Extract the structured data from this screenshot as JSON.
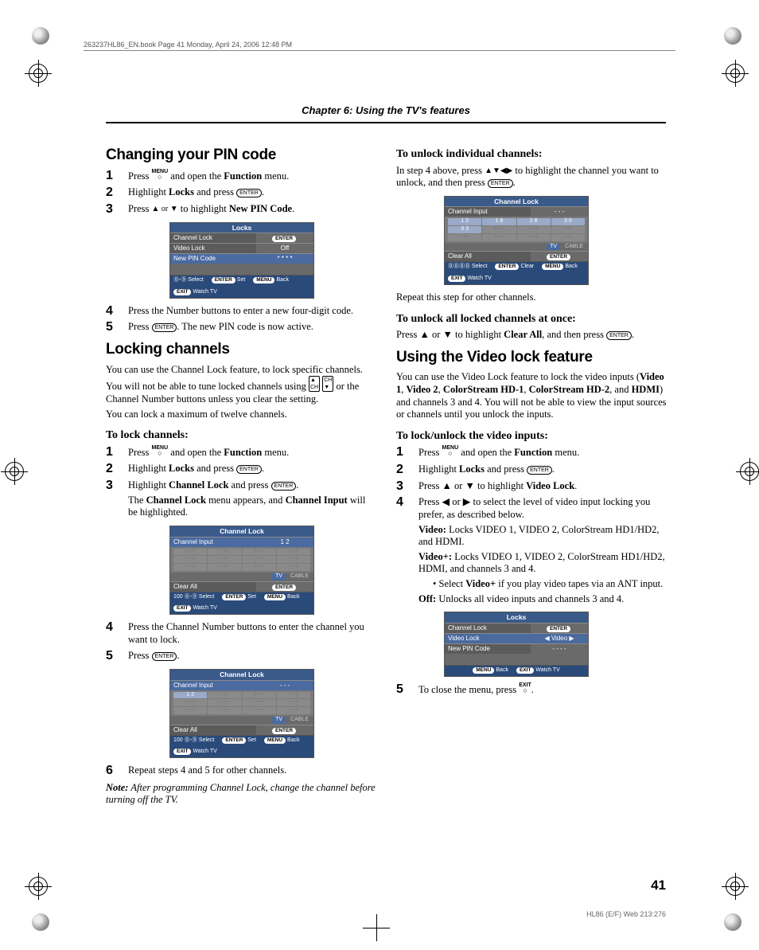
{
  "header_line": "263237HL86_EN.book  Page 41  Monday, April 24, 2006  12:48 PM",
  "chapter": "Chapter 6: Using the TV's features",
  "page_number": "41",
  "footer_right": "HL86 (E/F) Web 213:276",
  "left": {
    "h_changing": "Changing your PIN code",
    "steps_changing": [
      {
        "pre": "Press ",
        "icon": "MENU",
        "post": " and open the ",
        "bold": "Function",
        "tail": " menu."
      },
      {
        "pre": "Highlight ",
        "bold": "Locks",
        "post": " and press ",
        "icon2": "ENTER",
        "tail": "."
      },
      {
        "pre": "Press ",
        "tri": "▲ or ▼",
        "post": " to highlight ",
        "bold": "New PIN Code",
        "tail": "."
      }
    ],
    "step4_changing": "Press the Number buttons to enter a new four-digit code.",
    "step5_changing_pre": "Press ",
    "step5_changing_post": ". The new PIN code is now active.",
    "h_locking": "Locking channels",
    "locking_p1_a": "You can use the Channel Lock feature, to lock specific channels. You will not be able to tune locked channels using ",
    "locking_p1_b": " or the Channel Number buttons unless you clear the setting.",
    "locking_p2": "You can lock a maximum of twelve channels.",
    "sub_lock": "To lock channels:",
    "steps_lock": {
      "s1": {
        "pre": "Press ",
        "icon": "MENU",
        "post": " and open the ",
        "bold": "Function",
        "tail": " menu."
      },
      "s2": {
        "pre": "Highlight ",
        "bold": "Locks",
        "post": " and press ",
        "tail": "."
      },
      "s3a": {
        "pre": "Highlight ",
        "bold": "Channel Lock",
        "post": " and press ",
        "tail": "."
      },
      "s3b_pre": "The ",
      "s3b_b1": "Channel Lock",
      "s3b_mid": " menu appears, and ",
      "s3b_b2": "Channel Input",
      "s3b_post": " will be highlighted.",
      "s4": "Press the Channel Number buttons to enter the channel you want to lock.",
      "s5": "Press ",
      "s6": "Repeat steps 4 and 5 for other channels."
    },
    "note_label": "Note:",
    "note": " After programming Channel Lock, change the channel before turning off the TV."
  },
  "right": {
    "sub_unlock_indiv": "To unlock individual channels:",
    "unlock_indiv_p_a": "In step 4 above, press ",
    "unlock_indiv_tri": "▲▼◀▶",
    "unlock_indiv_p_b": " to highlight the channel you want to unlock, and then press ",
    "repeat": "Repeat this step for other channels.",
    "sub_unlock_all": "To unlock all locked channels at once:",
    "unlock_all_a": "Press ▲ or ▼ to highlight ",
    "unlock_all_bold": "Clear All",
    "unlock_all_b": ", and then press ",
    "h_video": "Using the Video lock feature",
    "video_p1_a": "You can use the Video Lock feature to lock the video inputs (",
    "video_p1_b1": "Video 1",
    "video_p1_c1": ", ",
    "video_p1_b2": "Video 2",
    "video_p1_c2": ", ",
    "video_p1_b3": "ColorStream HD-1",
    "video_p1_c3": ", ",
    "video_p1_b4": "ColorStream HD-2",
    "video_p1_c4": ", and ",
    "video_p1_b5": "HDMI",
    "video_p1_tail": ") and channels 3 and 4. You will not be able to view the input sources or channels until you unlock the inputs.",
    "sub_video": "To lock/unlock the video inputs:",
    "steps_video": {
      "s1": {
        "pre": "Press ",
        "icon": "MENU",
        "post": " and open the ",
        "bold": "Function",
        "tail": " menu."
      },
      "s2": {
        "pre": "Highlight ",
        "bold": "Locks",
        "post": " and press ",
        "tail": "."
      },
      "s3": {
        "pre": "Press ▲ or ▼ to highlight ",
        "bold": "Video Lock",
        "tail": "."
      },
      "s4a": "Press ◀ or ▶ to select the level of video input locking you prefer, as described below.",
      "s4_video_b": "Video:",
      "s4_video_t": " Locks VIDEO 1, VIDEO 2, ColorStream HD1/HD2, and HDMI.",
      "s4_videop_b": "Video+:",
      "s4_videop_t": " Locks VIDEO 1, VIDEO 2, ColorStream HD1/HD2, HDMI, and channels 3 and 4.",
      "s4_bullet": "Select Video+ if you play video tapes via an ANT input.",
      "s4_bullet_b": "Video+",
      "s4_bullet_pre": "Select ",
      "s4_bullet_post": " if you play video tapes via an ANT input.",
      "s4_off_b": "Off:",
      "s4_off_t": " Unlocks all video inputs and channels 3 and 4.",
      "s5_pre": "To close the menu, press ",
      "s5_icon": "EXIT"
    }
  },
  "osd": {
    "locks1": {
      "title": "Locks",
      "rows": [
        {
          "l": "Channel Lock",
          "r": "ENTER",
          "pill": true
        },
        {
          "l": "Video Lock",
          "r": "Off"
        },
        {
          "l": "New PIN Code",
          "r": "* * * *",
          "sel": true
        }
      ],
      "foot": [
        "Select",
        "ENTER Set",
        "MENU Back",
        "EXIT Watch TV"
      ]
    },
    "chlock1": {
      "title": "Channel Lock",
      "input_l": "Channel Input",
      "input_r": "1 2",
      "grid": [
        "- - -",
        "- - -",
        "- - -",
        "- - -",
        "- - -",
        "- - -",
        "- - -",
        "- - -",
        "- - -",
        "- - -",
        "- - -",
        "- - -"
      ],
      "tv": "TV",
      "cable": "CABLE",
      "clear_l": "Clear All",
      "clear_r": "ENTER",
      "foot": [
        "100 ⓪-⑨ Select",
        "ENTER Set",
        "MENU Back",
        "EXIT Watch TV"
      ]
    },
    "chlock2": {
      "title": "Channel Lock",
      "input_l": "Channel Input",
      "input_r": "- - -",
      "grid": [
        "1 2",
        "- - -",
        "- - -",
        "- - -",
        "- - -",
        "- - -",
        "- - -",
        "- - -",
        "- - -",
        "- - -",
        "- - -",
        "- - -"
      ],
      "tv": "TV",
      "cable": "CABLE",
      "clear_l": "Clear All",
      "clear_r": "ENTER",
      "foot": [
        "100 ⓪-⑨ Select",
        "ENTER Set",
        "MENU Back",
        "EXIT Watch TV"
      ]
    },
    "chlock3": {
      "title": "Channel Lock",
      "input_l": "Channel Input",
      "input_r": "- - -",
      "grid": [
        "1 2",
        "1 8",
        "2 8",
        "3 0",
        "3 3",
        "- - -",
        "- - -",
        "- - -",
        "- - -",
        "- - -",
        "- - -",
        "- - -"
      ],
      "tv": "TV",
      "cable": "CABLE",
      "clear_l": "Clear All",
      "clear_r": "ENTER",
      "foot": [
        "⓪⓪⓪⓪ Select",
        "ENTER Clear",
        "MENU Back",
        "EXIT Watch TV"
      ]
    },
    "locks2": {
      "title": "Locks",
      "rows": [
        {
          "l": "Channel Lock",
          "r": "ENTER",
          "pill": true
        },
        {
          "l": "Video Lock",
          "r": "Video",
          "sel": true,
          "arrows": true
        },
        {
          "l": "New PIN Code",
          "r": "- - - -"
        }
      ],
      "foot": [
        "MENU Back",
        "EXIT Watch TV"
      ]
    }
  }
}
